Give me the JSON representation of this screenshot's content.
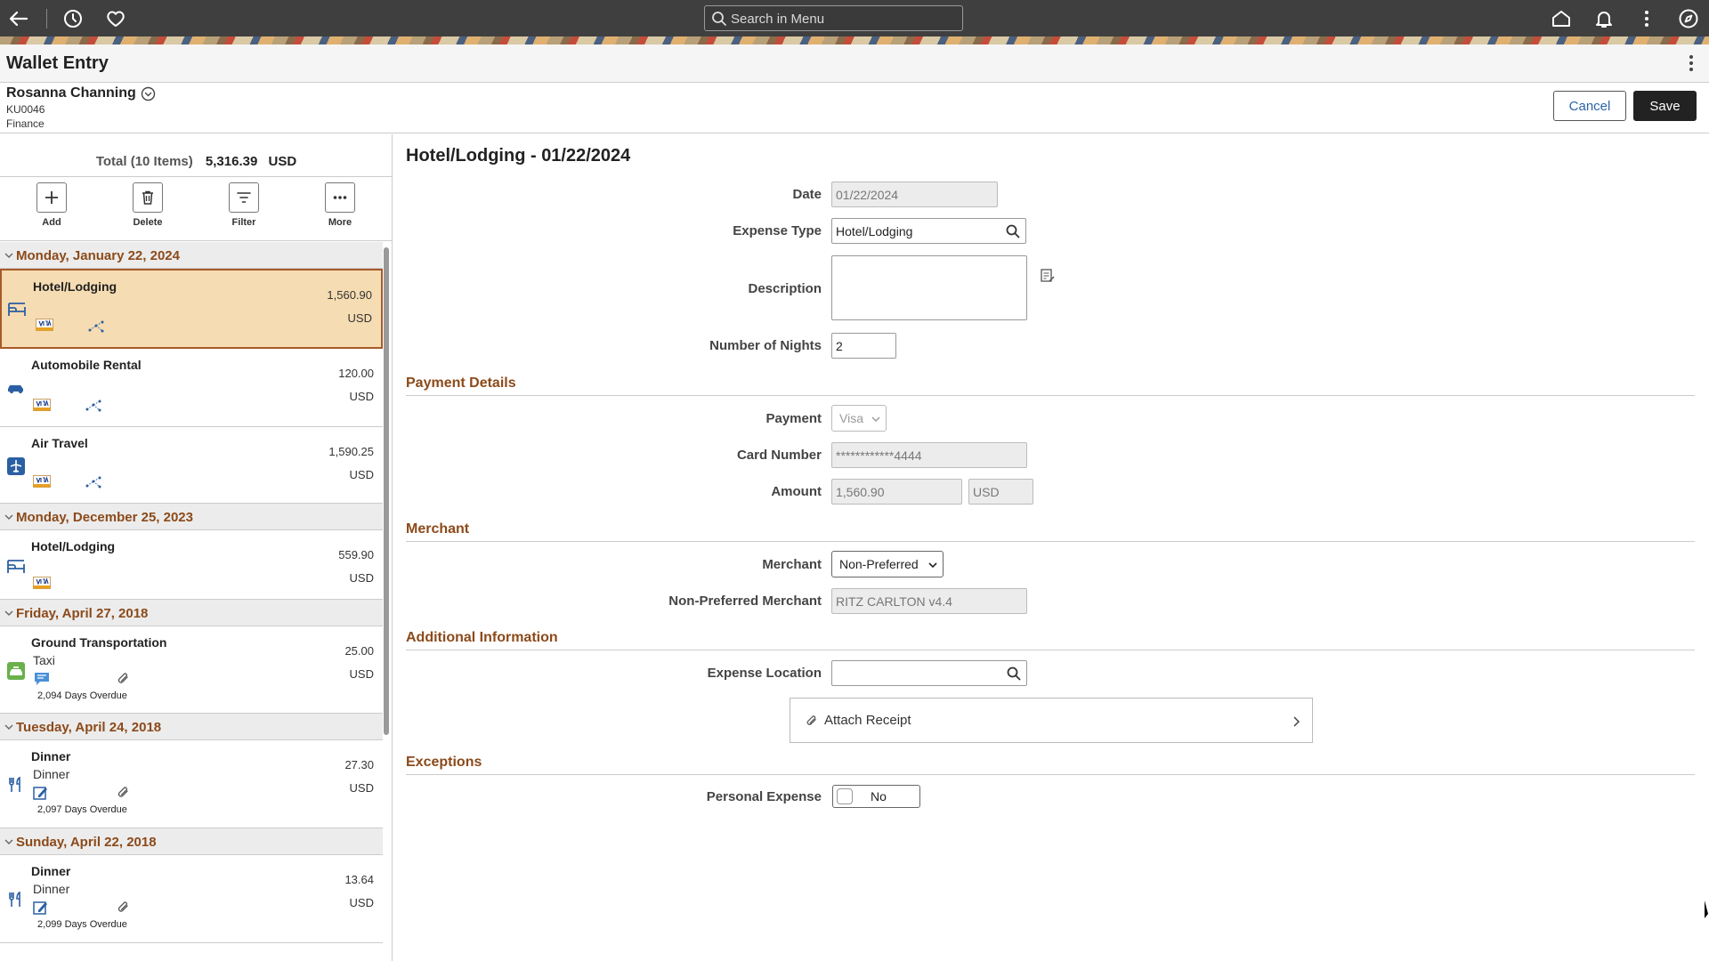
{
  "topbar": {
    "search_placeholder": "Search in Menu",
    "icons": [
      "back-arrow-icon",
      "recent-history-icon",
      "favorites-heart-icon",
      "home-icon",
      "notifications-bell-icon",
      "actions-kebab-icon",
      "navigator-compass-icon"
    ]
  },
  "page": {
    "title": "Wallet Entry"
  },
  "employee": {
    "name": "Rosanna Channing",
    "id": "KU0046",
    "department": "Finance"
  },
  "actions": {
    "cancel_label": "Cancel",
    "save_label": "Save"
  },
  "wallet": {
    "total_label": "Total (10 Items)",
    "total_amount": "5,316.39",
    "total_currency": "USD",
    "tools": [
      {
        "label": "Add",
        "icon": "plus-icon"
      },
      {
        "label": "Delete",
        "icon": "trash-icon"
      },
      {
        "label": "Filter",
        "icon": "filter-icon"
      },
      {
        "label": "More",
        "icon": "more-dots-icon"
      }
    ],
    "groups": [
      {
        "date": "Monday, January 22, 2024"
      },
      {
        "date": "Monday, December 25, 2023"
      },
      {
        "date": "Friday, April 27, 2018"
      },
      {
        "date": "Tuesday, April 24, 2018"
      },
      {
        "date": "Sunday, April 22, 2018"
      }
    ],
    "items": [
      {
        "type": "Hotel/Lodging",
        "amount": "1,560.90",
        "currency": "USD",
        "category_icon": "hotel-bed-icon",
        "payment_icon": "visa-card-icon",
        "selected": true
      },
      {
        "type": "Automobile Rental",
        "amount": "120.00",
        "currency": "USD",
        "category_icon": "car-icon",
        "payment_icon": "visa-card-icon"
      },
      {
        "type": "Air Travel",
        "amount": "1,590.25",
        "currency": "USD",
        "category_icon": "airplane-icon",
        "payment_icon": "visa-card-icon"
      },
      {
        "type": "Hotel/Lodging",
        "amount": "559.90",
        "currency": "USD",
        "category_icon": "hotel-bed-icon",
        "payment_icon": "visa-card-icon"
      },
      {
        "type": "Ground Transportation",
        "subtitle": "Taxi",
        "amount": "25.00",
        "currency": "USD",
        "overdue": "2,094 Days Overdue",
        "category_icon": "taxi-icon",
        "payment_icon": "comment-icon"
      },
      {
        "type": "Dinner",
        "subtitle": "Dinner",
        "amount": "27.30",
        "currency": "USD",
        "overdue": "2,097 Days Overdue",
        "category_icon": "fork-knife-icon",
        "payment_icon": "manual-entry-icon"
      },
      {
        "type": "Dinner",
        "subtitle": "Dinner",
        "amount": "13.64",
        "currency": "USD",
        "overdue": "2,099 Days Overdue",
        "category_icon": "fork-knife-icon",
        "payment_icon": "manual-entry-icon"
      }
    ]
  },
  "detail": {
    "title": "Hotel/Lodging - 01/22/2024",
    "date_label": "Date",
    "date_value": "01/22/2024",
    "expense_type_label": "Expense Type",
    "expense_type_value": "Hotel/Lodging",
    "description_label": "Description",
    "description_value": "",
    "nights_label": "Number of Nights",
    "nights_value": "2",
    "payment_section": "Payment Details",
    "payment_label": "Payment",
    "payment_value": "Visa",
    "card_label": "Card Number",
    "card_value": "************4444",
    "amount_label": "Amount",
    "amount_value": "1,560.90",
    "amount_currency": "USD",
    "merchant_section": "Merchant",
    "merchant_label": "Merchant",
    "merchant_value": "Non-Preferred",
    "np_merchant_label": "Non-Preferred Merchant",
    "np_merchant_value": "RITZ CARLTON v4.4",
    "additional_section": "Additional Information",
    "location_label": "Expense Location",
    "location_value": "",
    "attach_label": "Attach Receipt",
    "exceptions_section": "Exceptions",
    "personal_label": "Personal Expense",
    "personal_value": "No"
  }
}
